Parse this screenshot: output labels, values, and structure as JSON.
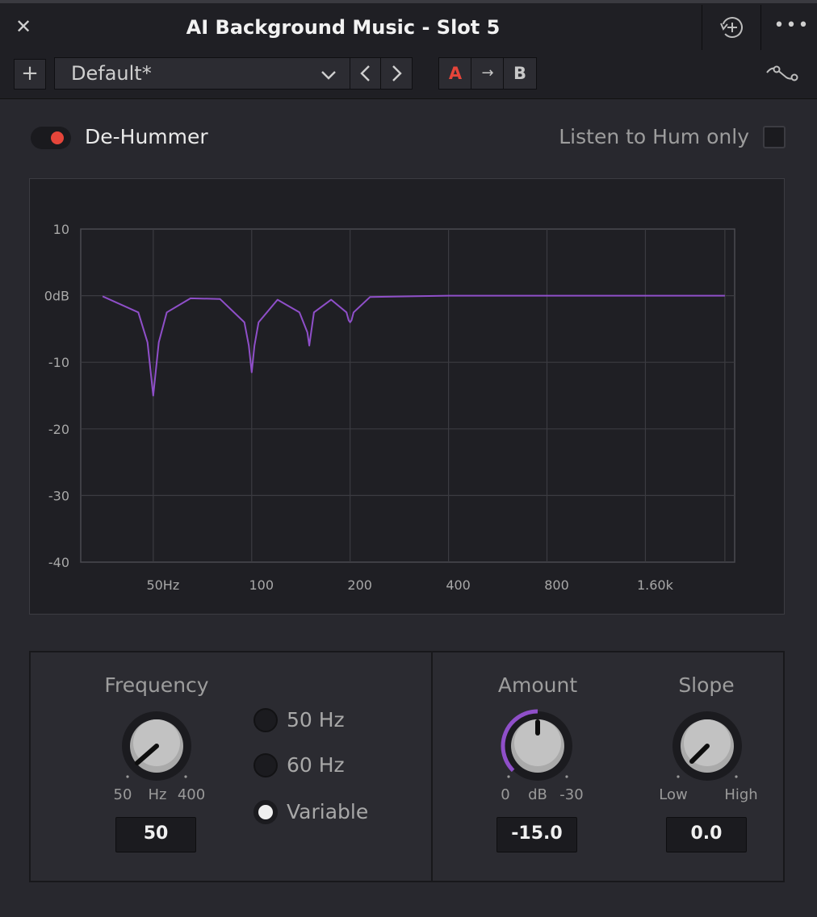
{
  "window": {
    "title": "AI Background Music - Slot 5",
    "close_icon": "close-icon",
    "history_icon": "history-icon",
    "more_icon": "more-icon"
  },
  "toolbar": {
    "add_label": "+",
    "preset_value": "Default*",
    "ab_a": "A",
    "ab_arrow": "→",
    "ab_b": "B",
    "accent_a": "#e5453a"
  },
  "plugin": {
    "enabled": true,
    "name": "De-Hummer",
    "listen_label": "Listen to Hum only",
    "listen_checked": false
  },
  "graph": {
    "y_ticks": [
      "10",
      "0dB",
      "-10",
      "-20",
      "-30",
      "-40"
    ],
    "x_ticks": [
      "50Hz",
      "100",
      "200",
      "400",
      "800",
      "1.60k"
    ],
    "curve_color": "#8f4fc9"
  },
  "chart_data": {
    "type": "line",
    "title": "",
    "xlabel": "",
    "ylabel": "",
    "x_scale": "log",
    "ylim": [
      -40,
      10
    ],
    "grid": true,
    "series": [
      {
        "x": [
          35,
          45,
          48,
          50,
          52,
          55,
          65,
          80,
          95,
          98,
          100,
          102,
          105,
          120,
          140,
          148,
          150,
          152,
          155,
          175,
          195,
          198,
          200,
          202,
          205,
          230,
          400,
          800,
          1600,
          2800
        ],
        "y": [
          -0.1,
          -2.5,
          -7,
          -15,
          -7,
          -2.5,
          -0.4,
          -0.5,
          -4,
          -7.5,
          -11.5,
          -7.5,
          -4,
          -0.6,
          -2.5,
          -5.5,
          -7.5,
          -5.5,
          -2.5,
          -0.6,
          -2.5,
          -3.7,
          -4,
          -3.7,
          -2.5,
          -0.2,
          0,
          0,
          0,
          0
        ]
      }
    ]
  },
  "frequency": {
    "label": "Frequency",
    "min_label": "50",
    "unit_label": "Hz",
    "max_label": "400",
    "value": "50",
    "options": [
      {
        "label": "50 Hz",
        "selected": false
      },
      {
        "label": "60 Hz",
        "selected": false
      },
      {
        "label": "Variable",
        "selected": true
      }
    ]
  },
  "amount": {
    "label": "Amount",
    "min_label": "0",
    "unit_label": "dB",
    "max_label": "-30",
    "value": "-15.0",
    "arc_color": "#8f4fc9"
  },
  "slope": {
    "label": "Slope",
    "min_label": "Low",
    "max_label": "High",
    "value": "0.0"
  }
}
